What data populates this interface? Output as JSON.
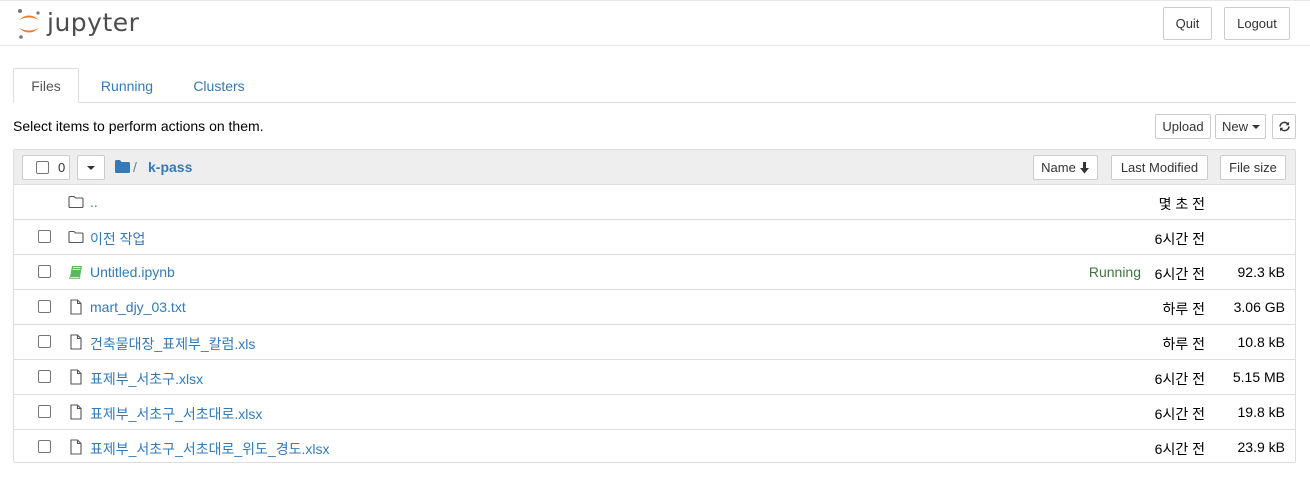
{
  "header": {
    "logo_text": "jupyter",
    "quit_label": "Quit",
    "logout_label": "Logout"
  },
  "tabs": [
    {
      "label": "Files"
    },
    {
      "label": "Running"
    },
    {
      "label": "Clusters"
    }
  ],
  "toolbar": {
    "instruction": "Select items to perform actions on them.",
    "upload_label": "Upload",
    "new_label": "New",
    "refresh_icon": "refresh-icon"
  },
  "list_header": {
    "selected_count": "0",
    "breadcrumb_sep": "/",
    "current_folder": "k-pass",
    "name_label": "Name",
    "last_modified_label": "Last Modified",
    "file_size_label": "File size"
  },
  "items": [
    {
      "name": "..",
      "icon": "folder-icon",
      "modified": "몇 초 전",
      "size": "",
      "status": ""
    },
    {
      "name": "이전 작업",
      "icon": "folder-icon",
      "modified": "6시간 전",
      "size": "",
      "status": ""
    },
    {
      "name": "Untitled.ipynb",
      "icon": "notebook-icon",
      "modified": "6시간 전",
      "size": "92.3 kB",
      "status": "Running"
    },
    {
      "name": "mart_djy_03.txt",
      "icon": "file-icon",
      "modified": "하루 전",
      "size": "3.06 GB",
      "status": ""
    },
    {
      "name": "건축물대장_표제부_칼럼.xls",
      "icon": "file-icon",
      "modified": "하루 전",
      "size": "10.8 kB",
      "status": ""
    },
    {
      "name": "표제부_서초구.xlsx",
      "icon": "file-icon",
      "modified": "6시간 전",
      "size": "5.15 MB",
      "status": ""
    },
    {
      "name": "표제부_서초구_서초대로.xlsx",
      "icon": "file-icon",
      "modified": "6시간 전",
      "size": "19.8 kB",
      "status": ""
    },
    {
      "name": "표제부_서초구_서초대로_위도_경도.xlsx",
      "icon": "file-icon",
      "modified": "6시간 전",
      "size": "23.9 kB",
      "status": ""
    }
  ],
  "colors": {
    "link": "#337ab7",
    "running": "#3c763d",
    "logo_orange": "#f37726",
    "notebook_green": "#5cb85c"
  }
}
